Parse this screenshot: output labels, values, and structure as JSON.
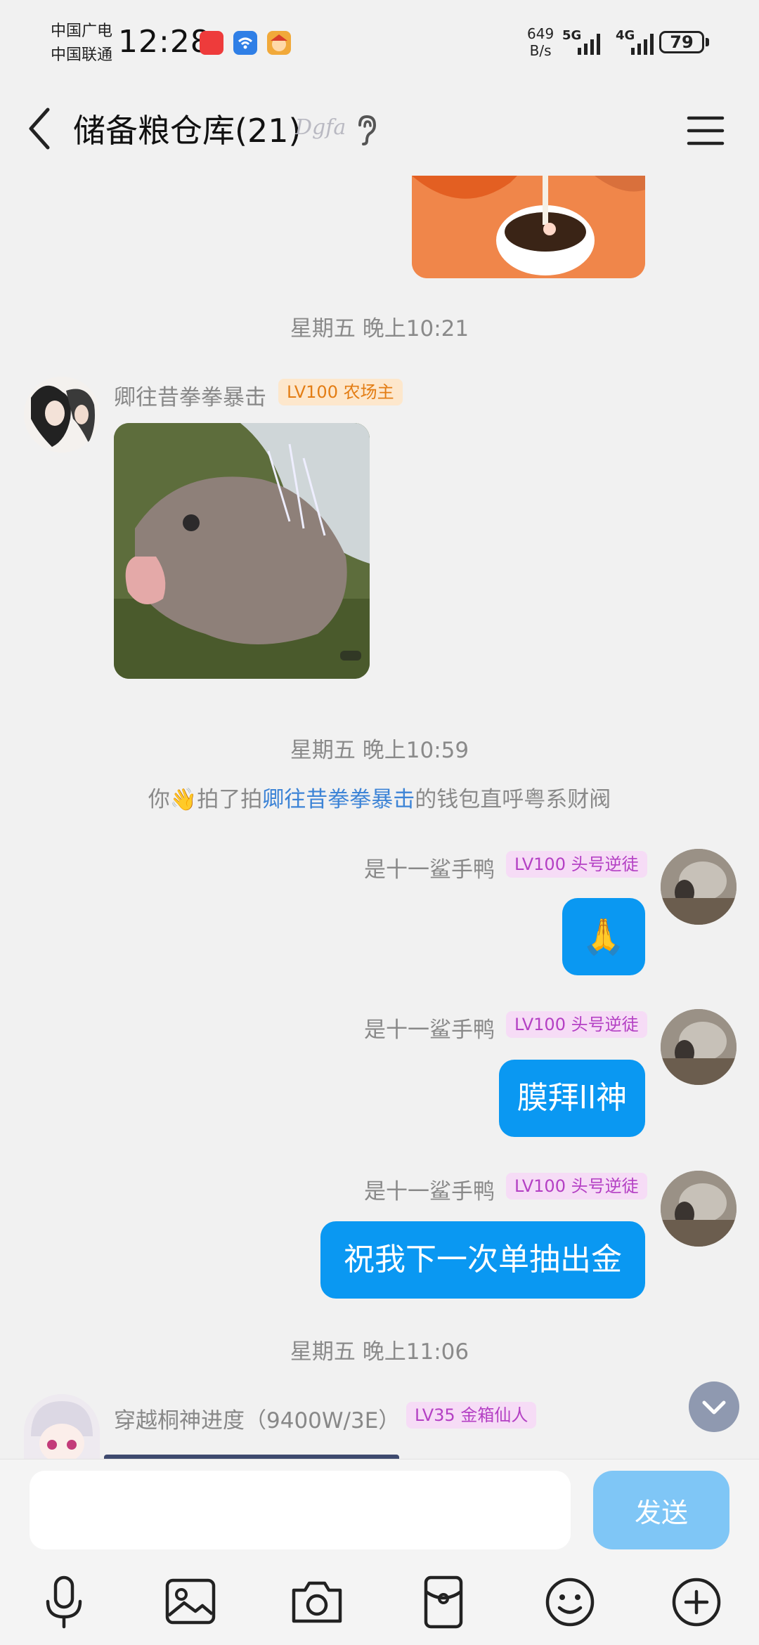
{
  "status_bar": {
    "carrier_1": "中国广电",
    "carrier_2": "中国联通",
    "time": "12:28",
    "net_speed_value": "649",
    "net_speed_unit": "B/s",
    "signal_1": "5G",
    "signal_2": "4G",
    "battery": "79"
  },
  "header": {
    "title": "储备粮仓库(21)",
    "badge": "Dgfa"
  },
  "messages": {
    "time_1": "星期五 晚上10:21",
    "sender_1": "卿往昔拳拳暴击",
    "sender_1_level": "LV100 农场主",
    "time_2": "星期五 晚上10:59",
    "system": {
      "prefix": "你",
      "action": "拍了拍",
      "target": "卿往昔拳拳暴击",
      "suffix": "的钱包直呼粤系财阀"
    },
    "me_name": "是十一鲨手鸭",
    "me_level": "LV100 头号逆徒",
    "bubble_1": "🙏",
    "bubble_2": "膜拜ll神",
    "bubble_3": "祝我下一次单抽出金",
    "time_3": "星期五 晚上11:06",
    "sender_2": "穿越桐神进度（9400W/3E）",
    "sender_2_level": "LV35 金箱仙人"
  },
  "input": {
    "placeholder": "",
    "send_label": "发送"
  },
  "toolbar": {
    "icons": [
      "microphone-icon",
      "image-icon",
      "camera-icon",
      "red-packet-icon",
      "emoji-icon",
      "plus-icon"
    ]
  },
  "colors": {
    "bubble": "#0a98f2",
    "send_button": "#7fc6f6",
    "link": "#3d84d6",
    "badge_orange": "#e37d14",
    "badge_purple": "#b440c4"
  }
}
